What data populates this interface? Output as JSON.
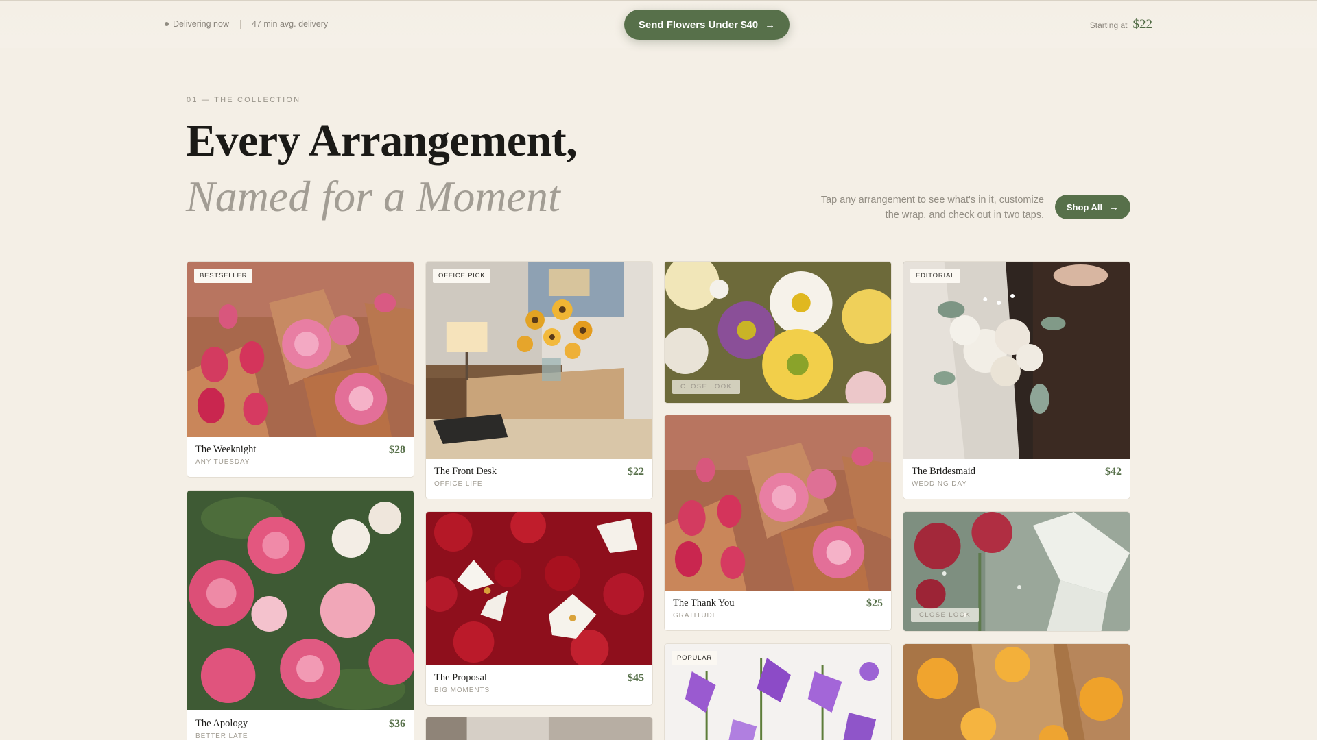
{
  "topbar": {
    "status": "Delivering now",
    "delivery_time": "47 min avg. delivery",
    "cta_label": "Send Flowers Under $40",
    "starting_label": "Starting at",
    "starting_price": "$22"
  },
  "header": {
    "eyebrow": "01 — THE COLLECTION",
    "title": "Every Arrangement,",
    "subtitle": "Named for a Moment",
    "description": "Tap any arrangement to see what's in it, customize the wrap, and check out in two taps.",
    "shop_all": "Shop All"
  },
  "cards": [
    {
      "badge": "BESTSELLER",
      "name": "The Weeknight",
      "tag": "ANY TUESDAY",
      "price": "$28"
    },
    {
      "name": "The Apology",
      "tag": "BETTER LATE",
      "price": "$36"
    },
    {
      "badge": "OFFICE PICK",
      "name": "The Front Desk",
      "tag": "OFFICE LIFE",
      "price": "$22"
    },
    {
      "name": "The Proposal",
      "tag": "BIG MOMENTS",
      "price": "$45"
    },
    {
      "overlay": "CLOSE LOOK"
    },
    {
      "name": "The Thank You",
      "tag": "GRATITUDE",
      "price": "$25"
    },
    {
      "badge": "POPULAR"
    },
    {
      "badge": "EDITORIAL",
      "name": "The Bridesmaid",
      "tag": "WEDDING DAY",
      "price": "$42"
    },
    {
      "overlay": "CLOSE LOOK"
    }
  ],
  "colors": {
    "background": "#f4efe6",
    "accent_green": "#57704a",
    "card_bg": "#ffffff"
  },
  "icons": {
    "arrow": "arrow-right-icon",
    "status_dot": "status-dot-icon"
  }
}
